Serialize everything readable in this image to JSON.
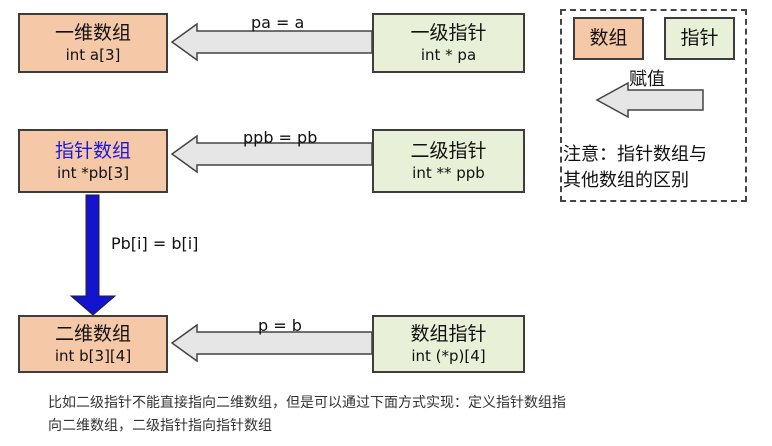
{
  "rows": [
    {
      "array_box": {
        "title": "一维数组",
        "decl": "int a[3]"
      },
      "assign": "pa = a",
      "pointer_box": {
        "title": "一级指针",
        "decl": "int * pa"
      }
    },
    {
      "array_box": {
        "title": "指针数组",
        "decl": "int *pb[3]"
      },
      "assign": "ppb = pb",
      "pointer_box": {
        "title": "二级指针",
        "decl": "int ** ppb"
      }
    },
    {
      "array_box": {
        "title": "二维数组",
        "decl": "int b[3][4]"
      },
      "assign": "p = b",
      "pointer_box": {
        "title": "数组指针",
        "decl": "int (*p)[4]"
      }
    }
  ],
  "vertical_assign": "Pb[i] = b[i]",
  "legend": {
    "array": "数组",
    "pointer": "指针",
    "assign": "赋值",
    "note_line1": "注意：指针数组与",
    "note_line2": "其他数组的区别"
  },
  "caption_line1": "比如二级指针不能直接指向二维数组，但是可以通过下面方式实现：定义指针数组指",
  "caption_line2": "向二维数组，二级指针指向指针数组",
  "colors": {
    "array_fill": "#f5c8a8",
    "pointer_fill": "#e8f0d8",
    "arrow_blue": "#1414d0",
    "arrow_gray": "#e6e6e6",
    "highlight_text": "#1a1ad6"
  }
}
